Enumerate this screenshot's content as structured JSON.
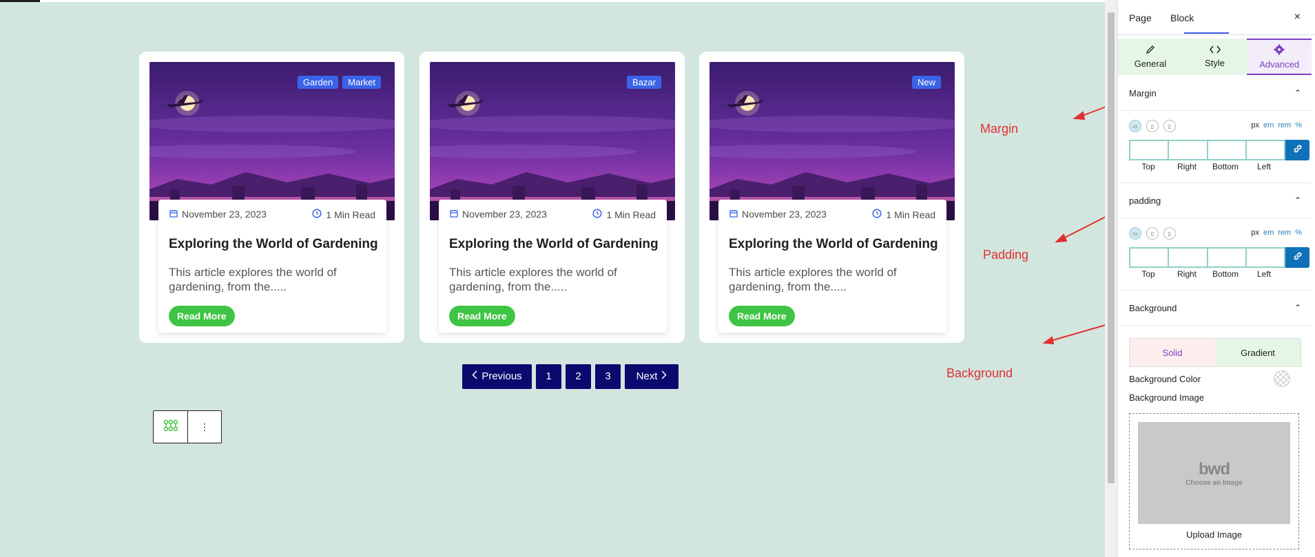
{
  "cards": [
    {
      "tags": [
        "Garden",
        "Market"
      ],
      "date": "November 23, 2023",
      "read_time": "1 Min Read",
      "title": "Exploring the World of Gardening",
      "excerpt": "This article explores the world of gardening, from the.....",
      "button": "Read More"
    },
    {
      "tags": [
        "Bazar"
      ],
      "date": "November 23, 2023",
      "read_time": "1 Min Read",
      "title": "Exploring the World of Gardening",
      "excerpt": "This article explores the world of gardening, from the.....",
      "button": "Read More"
    },
    {
      "tags": [
        "New"
      ],
      "date": "November 23, 2023",
      "read_time": "1 Min Read",
      "title": "Exploring the World of Gardening",
      "excerpt": "This article explores the world of gardening, from the.....",
      "button": "Read More"
    }
  ],
  "pagination": {
    "previous": "Previous",
    "pages": [
      "1",
      "2",
      "3"
    ],
    "next": "Next"
  },
  "block_toolbar": {
    "more": "⋮"
  },
  "annotations": {
    "margin": "Margin",
    "padding": "Padding",
    "background": "Background"
  },
  "sidebar": {
    "tabs": {
      "page": "Page",
      "block": "Block"
    },
    "close": "×",
    "subtabs": {
      "general": "General",
      "style": "Style",
      "advanced": "Advanced"
    },
    "margin": {
      "title": "Margin",
      "units": [
        "px",
        "em",
        "rem",
        "%"
      ],
      "labels": [
        "Top",
        "Right",
        "Bottom",
        "Left"
      ]
    },
    "padding": {
      "title": "padding",
      "units": [
        "px",
        "em",
        "rem",
        "%"
      ],
      "labels": [
        "Top",
        "Right",
        "Bottom",
        "Left"
      ]
    },
    "background": {
      "title": "Background",
      "solid": "Solid",
      "gradient": "Gradient",
      "color_label": "Background Color",
      "image_label": "Background Image",
      "logo_text": "bwd",
      "choose_text": "Choose an Image",
      "upload": "Upload Image"
    }
  },
  "colors": {
    "canvas_bg": "#d3e5df",
    "tag_blue": "#3a63e8",
    "read_more_green": "#3fc443",
    "pagination_navy": "#0a0a6e",
    "advanced_purple": "#7b3fbf",
    "annotation_red": "#e03030"
  }
}
